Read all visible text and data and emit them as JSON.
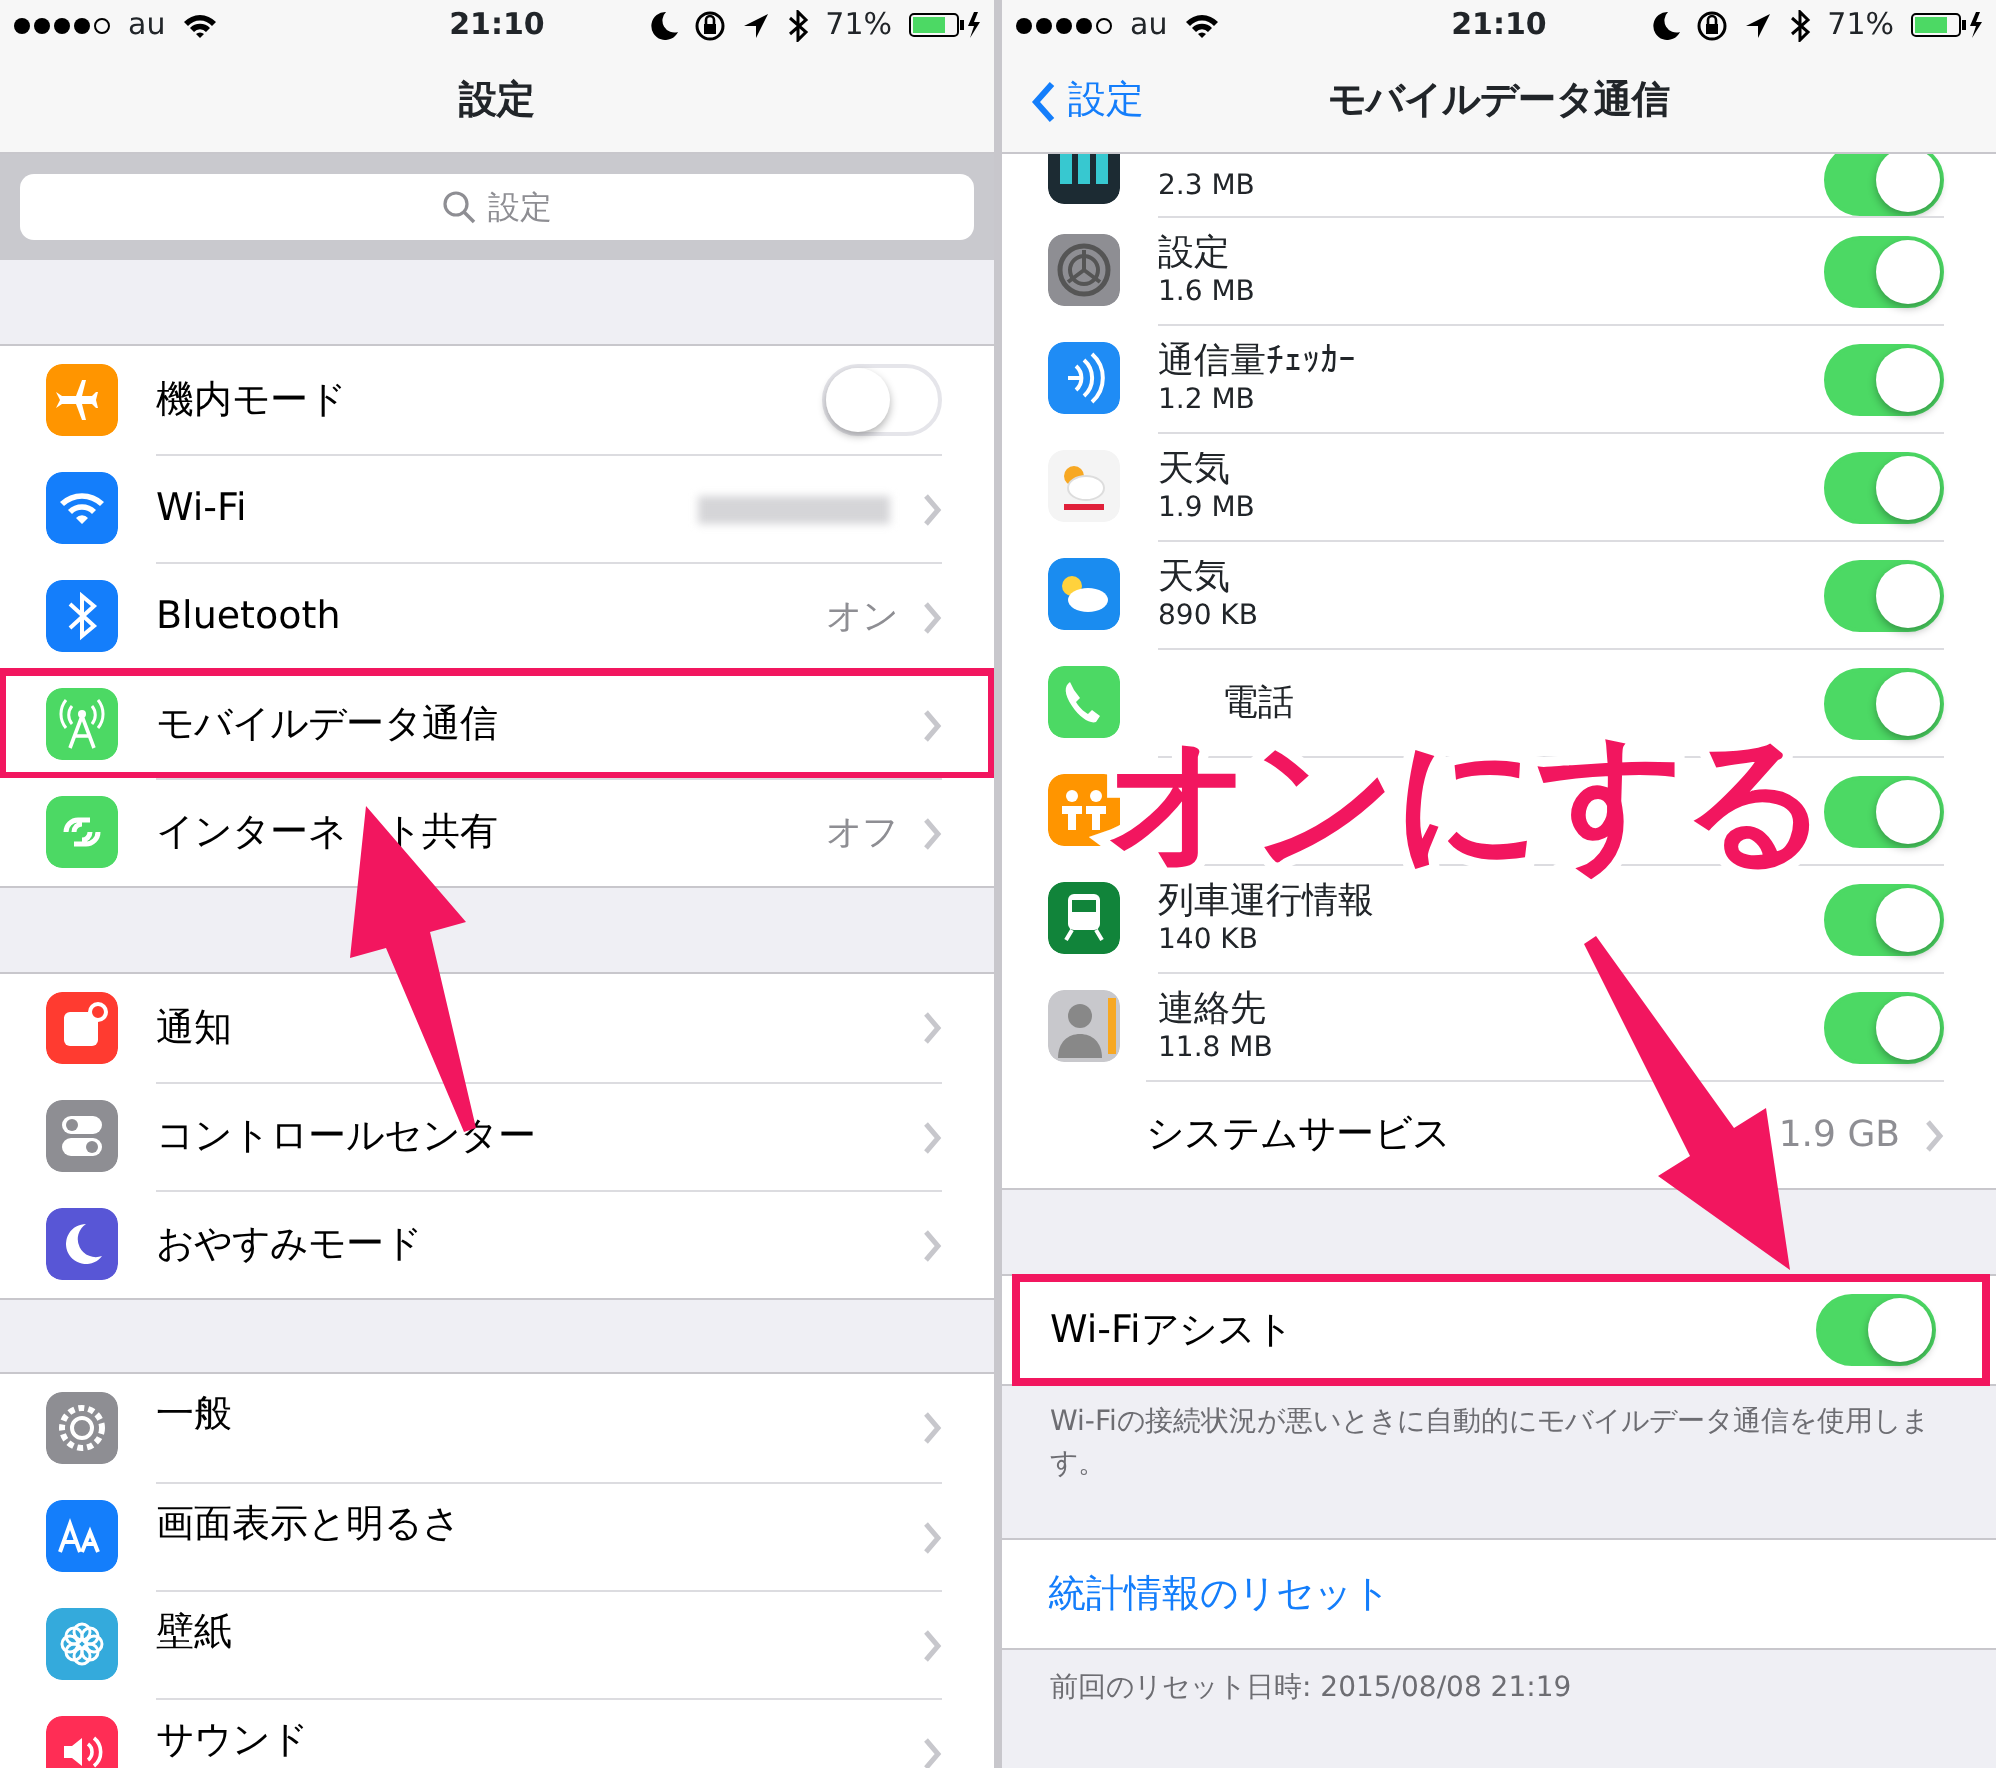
{
  "left_screen": {
    "status_bar": {
      "carrier": "au",
      "time": "21:10",
      "battery": "71%"
    },
    "title": "設定",
    "search": {
      "placeholder": "設定"
    },
    "groups": [
      [
        {
          "kind": "toggle",
          "label": "機内モード",
          "on": false,
          "highlighted": false
        },
        {
          "kind": "link",
          "label": "Wi-Fi",
          "value_hidden": true,
          "highlighted": false
        },
        {
          "kind": "link",
          "label": "Bluetooth",
          "value": "オン",
          "highlighted": false
        },
        {
          "kind": "link",
          "label": "モバイルデータ通信",
          "highlighted": true
        },
        {
          "kind": "link",
          "label_parts": [
            "インターネ",
            "ト共有"
          ],
          "value": "オフ",
          "highlighted": false
        }
      ],
      [
        {
          "kind": "link",
          "label": "通知",
          "highlighted": false
        },
        {
          "kind": "link",
          "label": "コントロールセンター",
          "highlighted": false
        },
        {
          "kind": "link",
          "label": "おやすみモード",
          "highlighted": false
        }
      ],
      [
        {
          "kind": "link",
          "label": "一般",
          "highlighted": false
        },
        {
          "kind": "link",
          "label": "画面表示と明るさ",
          "highlighted": false
        },
        {
          "kind": "link",
          "label": "壁紙",
          "highlighted": false
        },
        {
          "kind": "link",
          "label": "サウンド",
          "highlighted": false
        }
      ]
    ]
  },
  "right_screen": {
    "status_bar": {
      "carrier": "au",
      "time": "21:10",
      "battery": "71%"
    },
    "back": "設定",
    "title": "モバイルデータ通信",
    "apps": [
      {
        "size": "2.3 MB",
        "on": true
      },
      {
        "name": "設定",
        "size": "1.6 MB",
        "on": true
      },
      {
        "name": "通信量ﾁｪｯｶｰ",
        "size": "1.2 MB",
        "on": true
      },
      {
        "name": "天気",
        "size": "1.9 MB",
        "on": true
      },
      {
        "name": "天気",
        "size": "890 KB",
        "on": true
      },
      {
        "name": "電話",
        "on": true
      },
      {
        "on": true
      },
      {
        "name": "列車運行情報",
        "size": "140 KB",
        "on": true
      },
      {
        "name": "連絡先",
        "size": "11.8 MB",
        "on": true
      }
    ],
    "system_services": {
      "label": "システムサービス",
      "value": "1.9 GB"
    },
    "wifi_assist": {
      "label": "Wi-Fiアシスト",
      "on": true,
      "highlighted": true
    },
    "footnote": "Wi-Fiの接続状況が悪いときに自動的にモバイルデータ通信を使用します。",
    "reset_link": "統計情報のリセット",
    "last_reset": "前回のリセット日時: 2015/08/08 21:19"
  },
  "annotation": {
    "caption": "オンにする"
  }
}
